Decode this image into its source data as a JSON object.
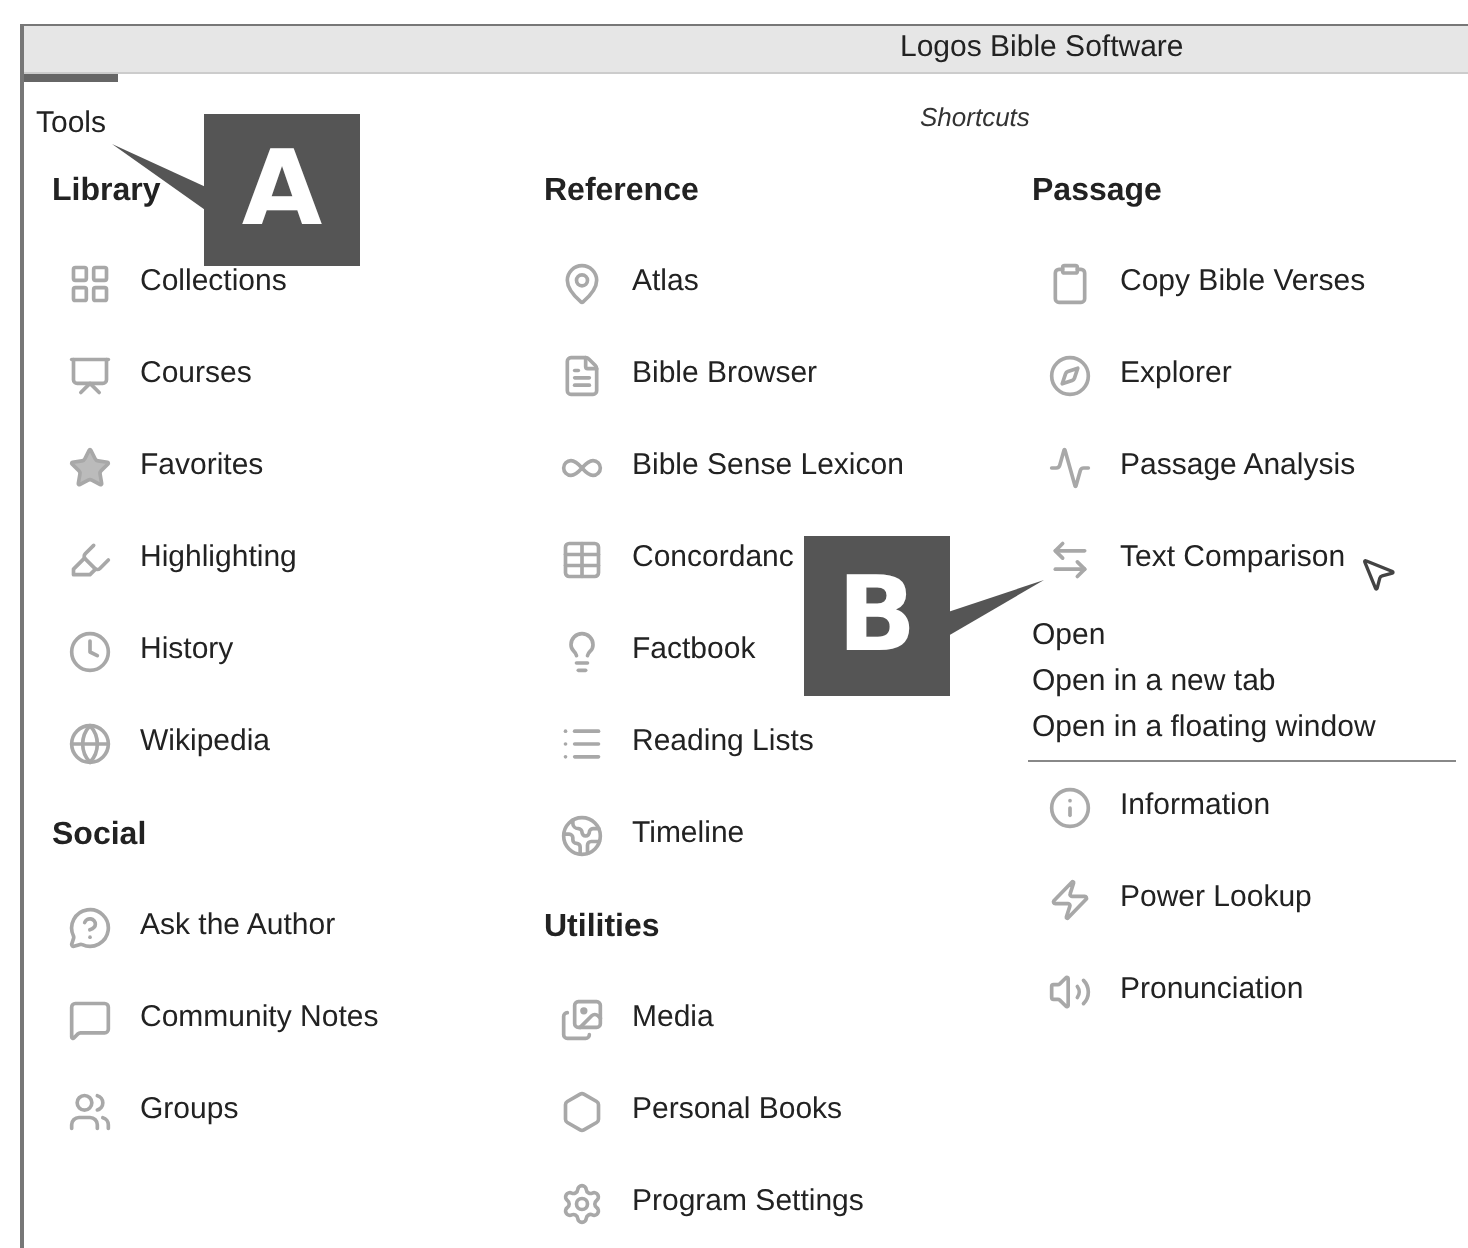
{
  "window": {
    "title": "Logos Bible Software"
  },
  "tabs": [
    {
      "label": "Tools",
      "selected": true
    }
  ],
  "shortcuts_label": "Shortcuts",
  "columns": [
    {
      "sections": [
        {
          "heading": "Library",
          "items": [
            {
              "label": "Collections"
            },
            {
              "label": "Courses"
            },
            {
              "label": "Favorites"
            },
            {
              "label": "Highlighting"
            },
            {
              "label": "History"
            },
            {
              "label": "Wikipedia"
            }
          ]
        },
        {
          "heading": "Social",
          "items": [
            {
              "label": "Ask the Author"
            },
            {
              "label": "Community Notes"
            },
            {
              "label": "Groups"
            }
          ]
        }
      ]
    },
    {
      "sections": [
        {
          "heading": "Reference",
          "items": [
            {
              "label": "Atlas"
            },
            {
              "label": "Bible Browser"
            },
            {
              "label": "Bible Sense Lexicon"
            },
            {
              "label": "Concordanc"
            },
            {
              "label": "Factbook"
            },
            {
              "label": "Reading Lists"
            },
            {
              "label": "Timeline"
            }
          ]
        },
        {
          "heading": "Utilities",
          "items": [
            {
              "label": "Media"
            },
            {
              "label": "Personal Books"
            },
            {
              "label": "Program Settings"
            }
          ]
        }
      ]
    },
    {
      "sections": [
        {
          "heading": "Passage",
          "items": [
            {
              "label": "Copy Bible Verses"
            },
            {
              "label": "Explorer"
            },
            {
              "label": "Passage Analysis"
            },
            {
              "label": "Text Comparison",
              "hovered": true,
              "menu": [
                "Open",
                "Open in a new tab",
                "Open in a floating window"
              ]
            },
            {
              "label": "Information"
            },
            {
              "label": "Power Lookup"
            },
            {
              "label": "Pronunciation"
            }
          ]
        }
      ]
    }
  ],
  "callouts": [
    {
      "label": "A"
    },
    {
      "label": "B"
    }
  ]
}
